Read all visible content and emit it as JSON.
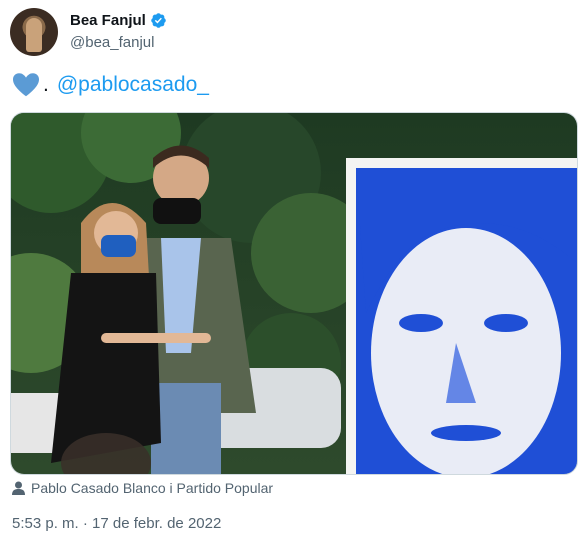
{
  "author": {
    "name": "Bea Fanjul",
    "handle": "@bea_fanjul",
    "verified_icon": "verified-badge-icon"
  },
  "tweet": {
    "emoji": "blue-heart-icon",
    "separator": ".",
    "mention": "@pablocasado_"
  },
  "media": {
    "tag_icon": "user-icon",
    "tag_text": "Pablo Casado Blanco i Partido Popular"
  },
  "meta": {
    "timestamp": "5:53 p. m. · 17 de febr. de 2022"
  },
  "colors": {
    "accent": "#1d9bf0",
    "heart": "#5b9bd5",
    "poster_blue": "#1f4fd6",
    "secondary_text": "#536471"
  }
}
